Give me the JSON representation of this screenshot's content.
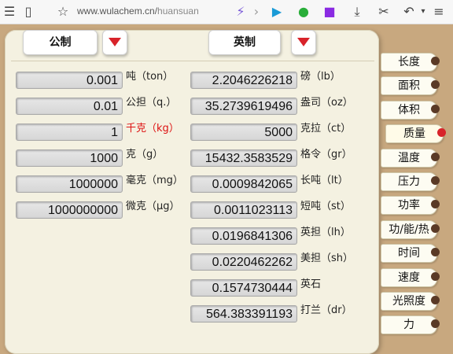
{
  "browser": {
    "url_host": "www.wulachem.cn/",
    "url_path": "huansuan"
  },
  "header": {
    "left_system": "公制",
    "right_system": "英制"
  },
  "metric": [
    {
      "value": "0.001",
      "unit": "吨（ton）"
    },
    {
      "value": "0.01",
      "unit": "公担（q.）"
    },
    {
      "value": "1",
      "unit": "千克（kg）"
    },
    {
      "value": "1000",
      "unit": "克（g）"
    },
    {
      "value": "1000000",
      "unit": "毫克（mg）"
    },
    {
      "value": "1000000000",
      "unit": "微克（μg）"
    }
  ],
  "imperial": [
    {
      "value": "2.2046226218",
      "unit": "磅（lb）"
    },
    {
      "value": "35.2739619496",
      "unit": "盎司（oz）"
    },
    {
      "value": "5000",
      "unit": "克拉（ct）"
    },
    {
      "value": "15432.3583529",
      "unit": "格令（gr）"
    },
    {
      "value": "0.0009842065",
      "unit": "长吨（lt）"
    },
    {
      "value": "0.0011023113",
      "unit": "短吨（st）"
    },
    {
      "value": "0.0196841306",
      "unit": "英担（lh）"
    },
    {
      "value": "0.0220462262",
      "unit": "美担（sh）"
    },
    {
      "value": "0.1574730444",
      "unit": "英石"
    },
    {
      "value": "564.383391193",
      "unit": "打兰（dr）"
    }
  ],
  "tabs": [
    "长度",
    "面积",
    "体积",
    "质量",
    "温度",
    "压力",
    "功率",
    "功/能/热",
    "时间",
    "速度",
    "光照度",
    "力"
  ],
  "active_tab": "质量",
  "colors": {
    "accent_red": "#d8232a",
    "highlight_unit": "#dd1111"
  }
}
